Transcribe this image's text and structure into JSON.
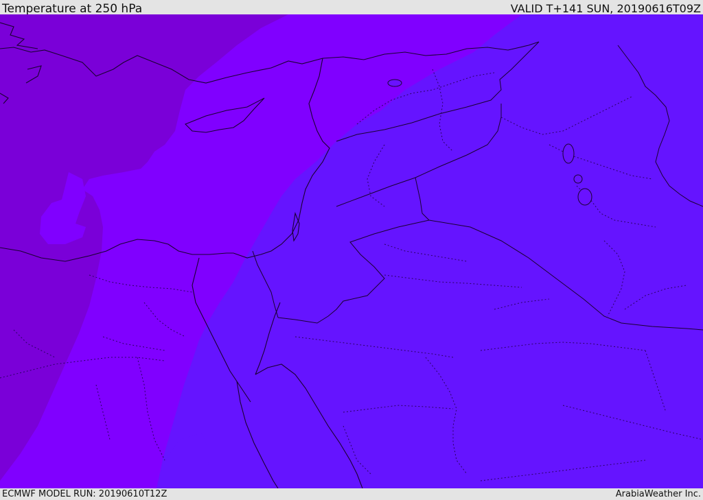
{
  "header": {
    "title": "Temperature at 250 hPa",
    "valid": "VALID T+141 SUN, 20190616T09Z"
  },
  "footer": {
    "model_run": "ECMWF MODEL RUN: 20190610T12Z",
    "credit": "ArabiaWeather Inc."
  },
  "colors": {
    "band_cold": "#7a00d8",
    "band_mid": "#8000ff",
    "band_warm": "#6514ff",
    "coast": "#1a0030",
    "frame": "#e4e4e4"
  }
}
